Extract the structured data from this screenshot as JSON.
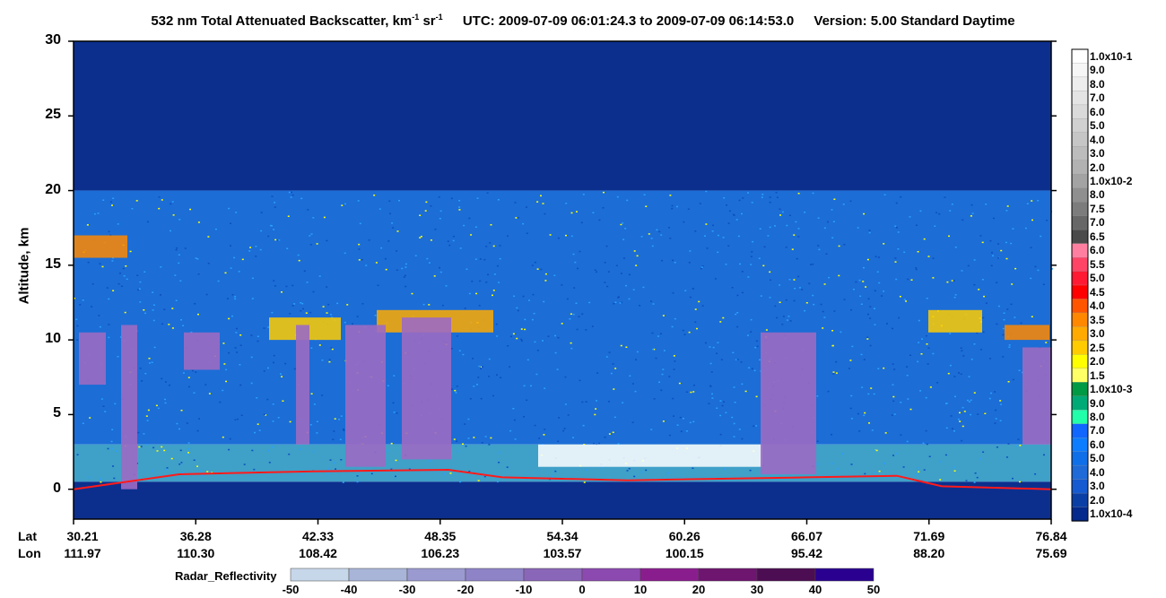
{
  "chart_data": {
    "type": "heatmap",
    "title": {
      "main": "532 nm Total Attenuated Backscatter, km",
      "unit_exp1": "-1",
      "unit_mid": " sr",
      "unit_exp2": "-1",
      "utc": "UTC:  2009-07-09 06:01:24.3  to  2009-07-09 06:14:53.0",
      "version": "Version: 5.00  Standard  Daytime"
    },
    "ylabel": "Altitude, km",
    "ylim": [
      -2,
      30
    ],
    "yticks": [
      "0",
      "5",
      "10",
      "15",
      "20",
      "25",
      "30"
    ],
    "yticks_values": [
      0,
      5,
      10,
      15,
      20,
      25,
      30
    ],
    "x_rows": {
      "lat_label": "Lat",
      "lon_label": "Lon",
      "lat": [
        "30.21",
        "36.28",
        "42.33",
        "48.35",
        "54.34",
        "60.26",
        "66.07",
        "71.69",
        "76.84"
      ],
      "lon": [
        "111.97",
        "110.30",
        "108.42",
        "106.23",
        "103.57",
        "100.15",
        "95.42",
        "88.20",
        "75.69"
      ]
    },
    "backscatter_colorbar": {
      "labels": [
        "1.0x10-1",
        "9.0",
        "8.0",
        "7.0",
        "6.0",
        "5.0",
        "4.0",
        "3.0",
        "2.0",
        "1.0x10-2",
        "8.0",
        "7.5",
        "7.0",
        "6.5",
        "6.0",
        "5.5",
        "5.0",
        "4.5",
        "4.0",
        "3.5",
        "3.0",
        "2.5",
        "2.0",
        "1.5",
        "1.0x10-3",
        "9.0",
        "8.0",
        "7.0",
        "6.0",
        "5.0",
        "4.0",
        "3.0",
        "2.0",
        "1.0x10-4"
      ],
      "colors": [
        "#ffffff",
        "#f6f6f6",
        "#ededed",
        "#e4e4e4",
        "#dadada",
        "#d0d0d0",
        "#c6c6c6",
        "#bcbcbc",
        "#b2b2b2",
        "#a3a3a3",
        "#8f8f8f",
        "#7c7c7c",
        "#676767",
        "#4a4a4a",
        "#ff7fa0",
        "#ff4466",
        "#ff1a33",
        "#ff0000",
        "#ff5500",
        "#ff8800",
        "#ffaa00",
        "#ffcc00",
        "#ffff00",
        "#ffff66",
        "#009944",
        "#00aa77",
        "#22ffaa",
        "#1166ff",
        "#0c7dff",
        "#0f6fe8",
        "#1d6ad8",
        "#155ad0",
        "#0a3fa6",
        "#032a8c"
      ]
    },
    "radar_colorbar": {
      "title": "Radar_Reflectivity",
      "ticks": [
        "-50",
        "-40",
        "-30",
        "-20",
        "-10",
        "0",
        "10",
        "20",
        "30",
        "40",
        "50"
      ],
      "colors": [
        "#c7d7ea",
        "#a8b4d8",
        "#9a9ad0",
        "#8f83c8",
        "#8a66b8",
        "#8c4ab0",
        "#8a1d8e",
        "#6e1570",
        "#4d0d52",
        "#2a0090"
      ]
    },
    "colors": {
      "background_high": "#0c2f8e",
      "background_mid": "#1c6dd6",
      "aerosol": "#3fa0c8",
      "speckle_yellow": "#ffff00",
      "surface_red": "#ff1a1a",
      "radar_cloud": "#9b6ac3"
    }
  }
}
